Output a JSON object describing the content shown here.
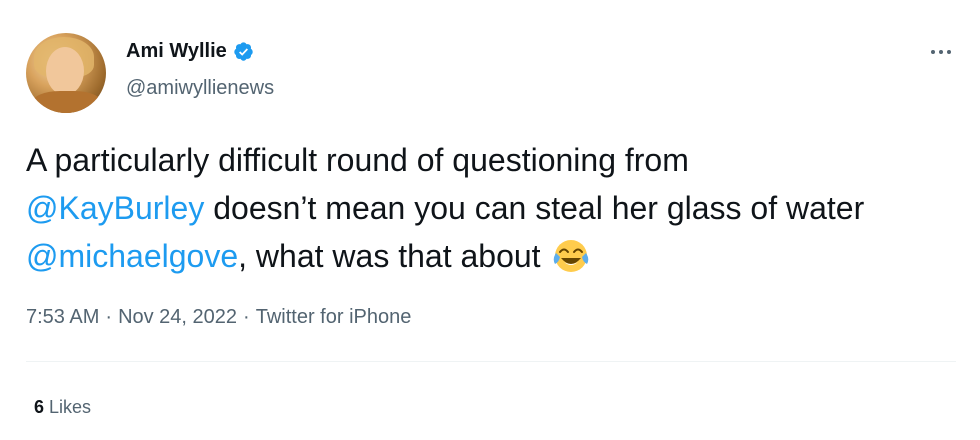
{
  "author": {
    "name": "Ami Wyllie",
    "handle": "@amiwyllienews"
  },
  "tweet": {
    "text_part1": "A particularly difficult round of questioning from",
    "mention1": "@KayBurley",
    "text_part2": " doesn’t mean you can steal her glass of water ",
    "mention2": "@michaelgove",
    "text_part3": ", what was that about "
  },
  "meta": {
    "time": "7:53 AM",
    "separator1": "·",
    "date": "Nov 24, 2022",
    "separator2": "·",
    "source": "Twitter for iPhone"
  },
  "engagement": {
    "likes_count": "6",
    "likes_label": "Likes"
  },
  "icons": {
    "verified": "verified-badge-icon",
    "more": "more-options-icon",
    "emoji": "face-with-tears-of-joy-emoji"
  },
  "colors": {
    "accent": "#1d9bf0",
    "text": "#0f1419",
    "secondary": "#536471",
    "divider": "#eff3f4"
  }
}
